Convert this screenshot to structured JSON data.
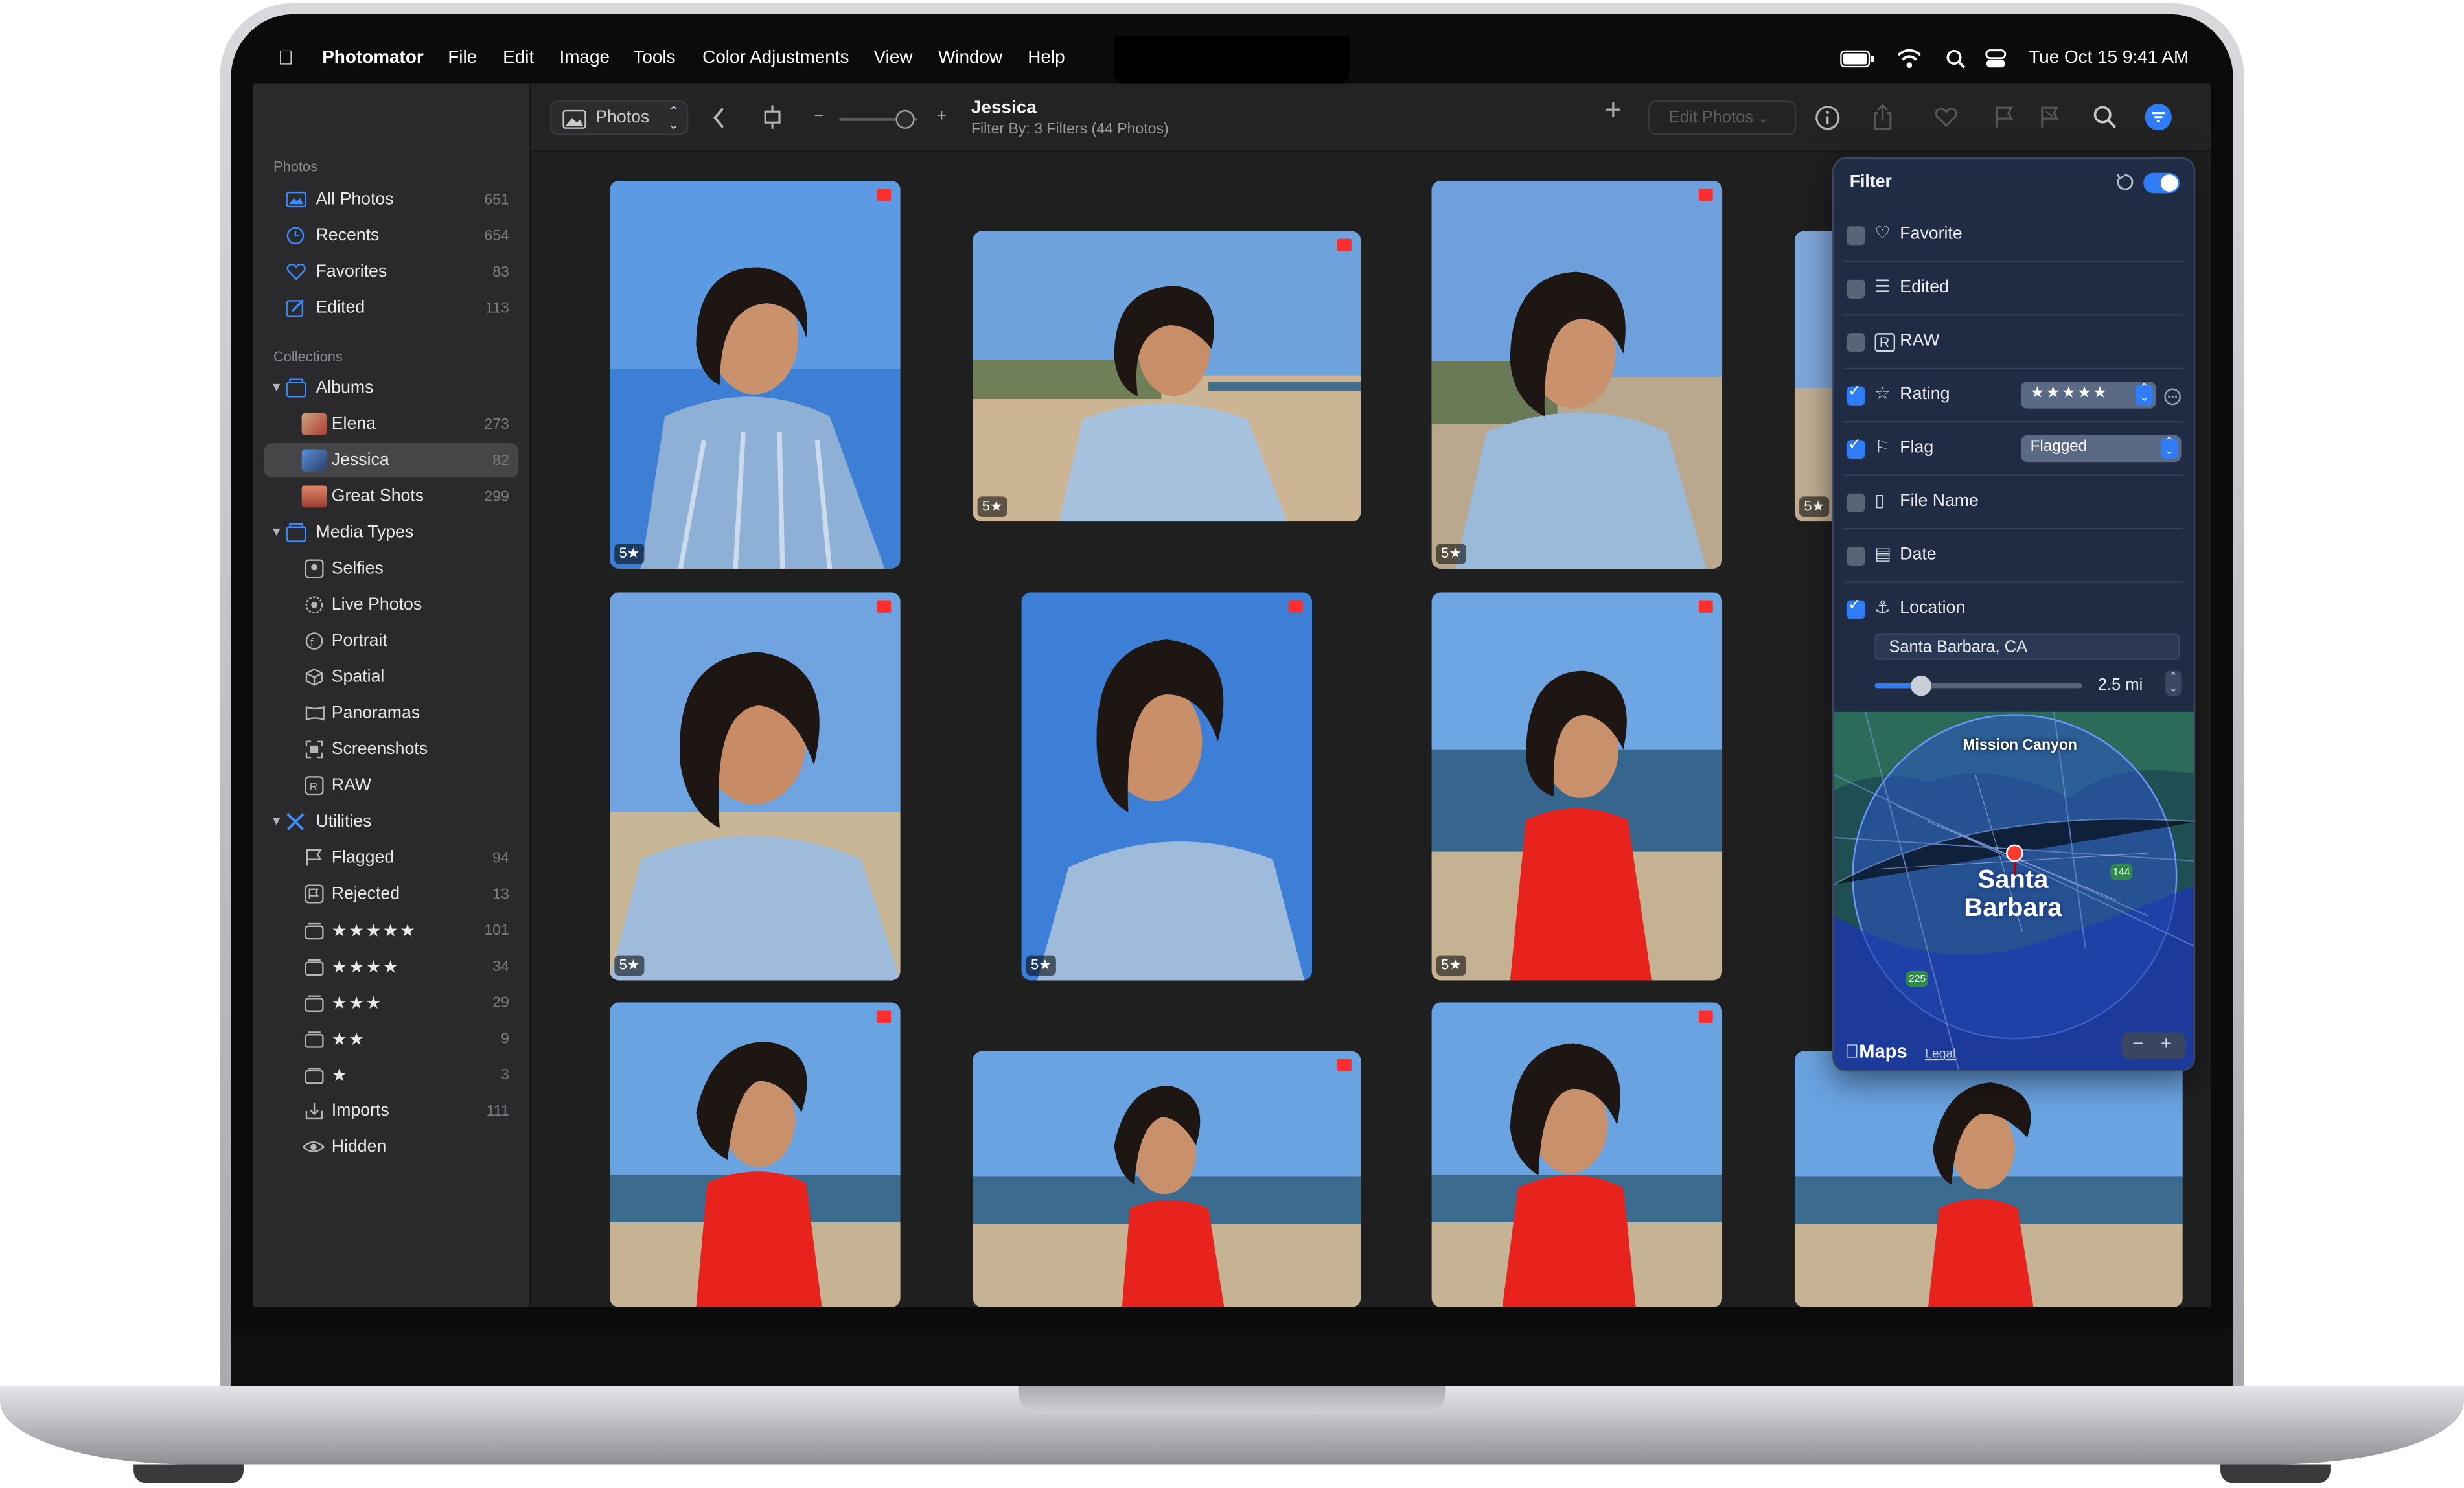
{
  "menubar": {
    "app": "Photomator",
    "items": [
      "File",
      "Edit",
      "Image",
      "Tools",
      "Color Adjustments",
      "View",
      "Window",
      "Help"
    ],
    "clock": "Tue Oct 15  9:41 AM"
  },
  "sidebar": {
    "photos_header": "Photos",
    "photos": [
      {
        "label": "All Photos",
        "count": "651"
      },
      {
        "label": "Recents",
        "count": "654"
      },
      {
        "label": "Favorites",
        "count": "83"
      },
      {
        "label": "Edited",
        "count": "113"
      }
    ],
    "collections_header": "Collections",
    "albums_group": "Albums",
    "albums": [
      {
        "label": "Elena",
        "count": "273"
      },
      {
        "label": "Jessica",
        "count": "82"
      },
      {
        "label": "Great Shots",
        "count": "299"
      }
    ],
    "media_group": "Media Types",
    "media": [
      "Selfies",
      "Live Photos",
      "Portrait",
      "Spatial",
      "Panoramas",
      "Screenshots",
      "RAW"
    ],
    "utilities_group": "Utilities",
    "utilities": [
      {
        "label": "Flagged",
        "count": "94"
      },
      {
        "label": "Rejected",
        "count": "13"
      },
      {
        "label": "★★★★★",
        "count": "101"
      },
      {
        "label": "★★★★",
        "count": "34"
      },
      {
        "label": "★★★",
        "count": "29"
      },
      {
        "label": "★★",
        "count": "9"
      },
      {
        "label": "★",
        "count": "3"
      },
      {
        "label": "Imports",
        "count": "111"
      },
      {
        "label": "Hidden",
        "count": ""
      }
    ]
  },
  "toolbar": {
    "source": "Photos",
    "title": "Jessica",
    "subtitle": "Filter By: 3 Filters (44 Photos)",
    "edit": "Edit Photos"
  },
  "photos": {
    "rating_badge": "5★"
  },
  "filter": {
    "title": "Filter",
    "rows": [
      {
        "label": "Favorite",
        "checked": false
      },
      {
        "label": "Edited",
        "checked": false
      },
      {
        "label": "RAW",
        "checked": false
      },
      {
        "label": "Rating",
        "checked": true,
        "value": "★★★★★"
      },
      {
        "label": "Flag",
        "checked": true,
        "value": "Flagged"
      },
      {
        "label": "File Name",
        "checked": false
      },
      {
        "label": "Date",
        "checked": false
      },
      {
        "label": "Location",
        "checked": true
      }
    ],
    "location": "Santa Barbara, CA",
    "distance": "2.5 mi",
    "map_label": "Mission Canyon",
    "city": "Santa Barbara",
    "route_a": "144",
    "route_b": "225",
    "maps_brand": "Maps",
    "legal": "Legal"
  },
  "colors": {
    "accent": "#2f7cf6",
    "flag": "#ff2d2d"
  }
}
